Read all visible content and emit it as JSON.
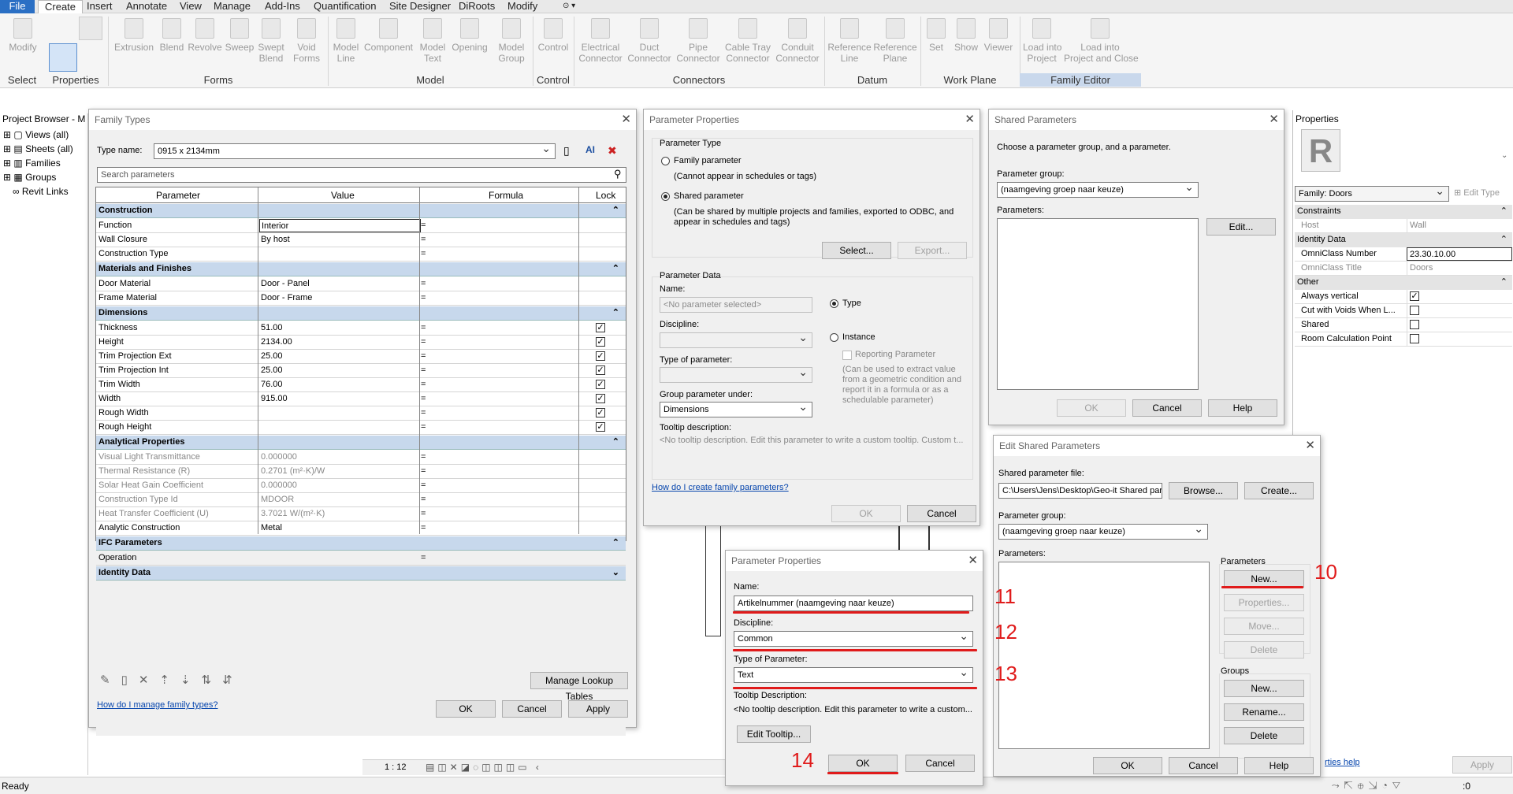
{
  "ribbon": {
    "tabs": [
      "File",
      "Create",
      "Insert",
      "Annotate",
      "View",
      "Manage",
      "Add-Ins",
      "Quantification",
      "Site Designer",
      "DiRoots",
      "Modify"
    ],
    "buttons": [
      {
        "label": "Modify"
      },
      {
        "label": "Extrusion"
      },
      {
        "label": "Blend"
      },
      {
        "label": "Revolve"
      },
      {
        "label": "Sweep"
      },
      {
        "label": "Swept\nBlend"
      },
      {
        "label": "Void\nForms"
      },
      {
        "label": "Model\nLine"
      },
      {
        "label": "Component"
      },
      {
        "label": "Model\nText"
      },
      {
        "label": "Opening"
      },
      {
        "label": "Model\nGroup"
      },
      {
        "label": "Control"
      },
      {
        "label": "Electrical\nConnector"
      },
      {
        "label": "Duct\nConnector"
      },
      {
        "label": "Pipe\nConnector"
      },
      {
        "label": "Cable Tray\nConnector"
      },
      {
        "label": "Conduit\nConnector"
      },
      {
        "label": "Reference\nLine"
      },
      {
        "label": "Reference\nPlane"
      },
      {
        "label": "Set"
      },
      {
        "label": "Show"
      },
      {
        "label": "Viewer"
      },
      {
        "label": "Load into\nProject"
      },
      {
        "label": "Load into\nProject and Close"
      }
    ],
    "groups": [
      "Select",
      "Properties",
      "Forms",
      "Model",
      "Control",
      "Connectors",
      "Datum",
      "Work Plane",
      "Family Editor"
    ]
  },
  "project_browser": {
    "title": "Project Browser - M",
    "items": [
      "Views (all)",
      "Sheets (all)",
      "Families",
      "Groups",
      "Revit Links"
    ]
  },
  "family_types": {
    "title": "Family Types",
    "type_name_label": "Type name:",
    "type_name": "0915 x 2134mm",
    "search_placeholder": "Search parameters",
    "headers": [
      "Parameter",
      "Value",
      "Formula",
      "Lock"
    ],
    "groups": [
      {
        "name": "Construction",
        "rows": [
          [
            "Function",
            "Interior",
            "=",
            ""
          ],
          [
            "Wall Closure",
            "By host",
            "=",
            ""
          ],
          [
            "Construction Type",
            "",
            "=",
            ""
          ]
        ]
      },
      {
        "name": "Materials and Finishes",
        "rows": [
          [
            "Door Material",
            "Door - Panel",
            "=",
            ""
          ],
          [
            "Frame Material",
            "Door - Frame",
            "=",
            ""
          ]
        ]
      },
      {
        "name": "Dimensions",
        "rows": [
          [
            "Thickness",
            "51.00",
            "=",
            "✓"
          ],
          [
            "Height",
            "2134.00",
            "=",
            "✓"
          ],
          [
            "Trim Projection Ext",
            "25.00",
            "=",
            "✓"
          ],
          [
            "Trim Projection Int",
            "25.00",
            "=",
            "✓"
          ],
          [
            "Trim Width",
            "76.00",
            "=",
            "✓"
          ],
          [
            "Width",
            "915.00",
            "=",
            "✓"
          ],
          [
            "Rough Width",
            "",
            "=",
            "✓"
          ],
          [
            "Rough Height",
            "",
            "=",
            "✓"
          ]
        ]
      },
      {
        "name": "Analytical Properties",
        "rows": [
          [
            "Visual Light Transmittance",
            "0.000000",
            "=",
            ""
          ],
          [
            "Thermal Resistance (R)",
            "0.2701 (m²·K)/W",
            "=",
            ""
          ],
          [
            "Solar Heat Gain Coefficient",
            "0.000000",
            "=",
            ""
          ],
          [
            "Construction Type Id",
            "MDOOR",
            "=",
            ""
          ],
          [
            "Heat Transfer Coefficient (U)",
            "3.7021 W/(m²·K)",
            "=",
            ""
          ],
          [
            "Analytic Construction",
            "Metal",
            "=",
            ""
          ]
        ]
      },
      {
        "name": "IFC Parameters",
        "rows": [
          [
            "Operation",
            "",
            "=",
            ""
          ]
        ]
      },
      {
        "name": "Identity Data",
        "rows": []
      }
    ],
    "manage_lookup": "Manage Lookup Tables",
    "help_link": "How do I manage family types?",
    "ok": "OK",
    "cancel": "Cancel",
    "apply": "Apply"
  },
  "param_props_1": {
    "title": "Parameter Properties",
    "type_heading": "Parameter Type",
    "family_param": "Family parameter",
    "family_note": "(Cannot appear in schedules or tags)",
    "shared_param": "Shared parameter",
    "shared_note": "(Can be shared by multiple projects and families, exported to ODBC, and appear in schedules and tags)",
    "select": "Select...",
    "export": "Export...",
    "data_heading": "Parameter Data",
    "name_label": "Name:",
    "name_value": "<No parameter selected>",
    "discipline_label": "Discipline:",
    "type_label": "Type of parameter:",
    "group_label": "Group parameter under:",
    "group_value": "Dimensions",
    "tooltip_label": "Tooltip description:",
    "tooltip_value": "<No tooltip description. Edit this parameter to write a custom tooltip. Custom t...",
    "type_radio": "Type",
    "instance_radio": "Instance",
    "reporting": "Reporting Parameter",
    "reporting_note": "(Can be used to extract value from a geometric condition and report it in a formula or as a schedulable parameter)",
    "help_link": "How do I create family parameters?",
    "ok": "OK",
    "cancel": "Cancel"
  },
  "shared_params": {
    "title": "Shared Parameters",
    "instruction": "Choose a parameter group, and a parameter.",
    "group_label": "Parameter group:",
    "group_value": "(naamgeving groep naar keuze)",
    "params_label": "Parameters:",
    "edit": "Edit...",
    "ok": "OK",
    "cancel": "Cancel",
    "help": "Help"
  },
  "edit_shared": {
    "title": "Edit Shared Parameters",
    "file_label": "Shared parameter file:",
    "file_value": "C:\\Users\\Jens\\Desktop\\Geo-it Shared par",
    "browse": "Browse...",
    "create": "Create...",
    "group_label": "Parameter group:",
    "group_value": "(naamgeving groep naar keuze)",
    "params_label": "Parameters:",
    "params_box": "Parameters",
    "new": "New...",
    "properties": "Properties...",
    "move": "Move...",
    "delete": "Delete",
    "groups_box": "Groups",
    "g_new": "New...",
    "rename": "Rename...",
    "g_delete": "Delete",
    "ok": "OK",
    "cancel": "Cancel",
    "help": "Help"
  },
  "param_props_2": {
    "title": "Parameter Properties",
    "name_label": "Name:",
    "name_value": "Artikelnummer (naamgeving naar keuze)",
    "discipline_label": "Discipline:",
    "discipline_value": "Common",
    "type_label": "Type of Parameter:",
    "type_value": "Text",
    "tooltip_label": "Tooltip Description:",
    "tooltip_value": "<No tooltip description. Edit this parameter to write a custom...",
    "edit_tooltip": "Edit Tooltip...",
    "ok": "OK",
    "cancel": "Cancel"
  },
  "annotations": [
    "10",
    "11",
    "12",
    "13",
    "14"
  ],
  "properties_panel": {
    "title": "Properties",
    "family": "Family: Doors",
    "edit_type": "Edit Type",
    "sections": [
      {
        "name": "Constraints",
        "rows": [
          [
            "Host",
            "Wall"
          ]
        ]
      },
      {
        "name": "Identity Data",
        "rows": [
          [
            "OmniClass Number",
            "23.30.10.00"
          ],
          [
            "OmniClass Title",
            "Doors"
          ]
        ]
      },
      {
        "name": "Other",
        "rows": [
          [
            "Always vertical",
            "✓"
          ],
          [
            "Cut with Voids When L...",
            ""
          ],
          [
            "Shared",
            ""
          ],
          [
            "Room Calculation Point",
            ""
          ]
        ]
      }
    ],
    "help_link": "rties help",
    "apply": "Apply"
  },
  "view": {
    "scale": "1 : 12"
  },
  "status": {
    "text": "Ready",
    "filter": ":0"
  }
}
